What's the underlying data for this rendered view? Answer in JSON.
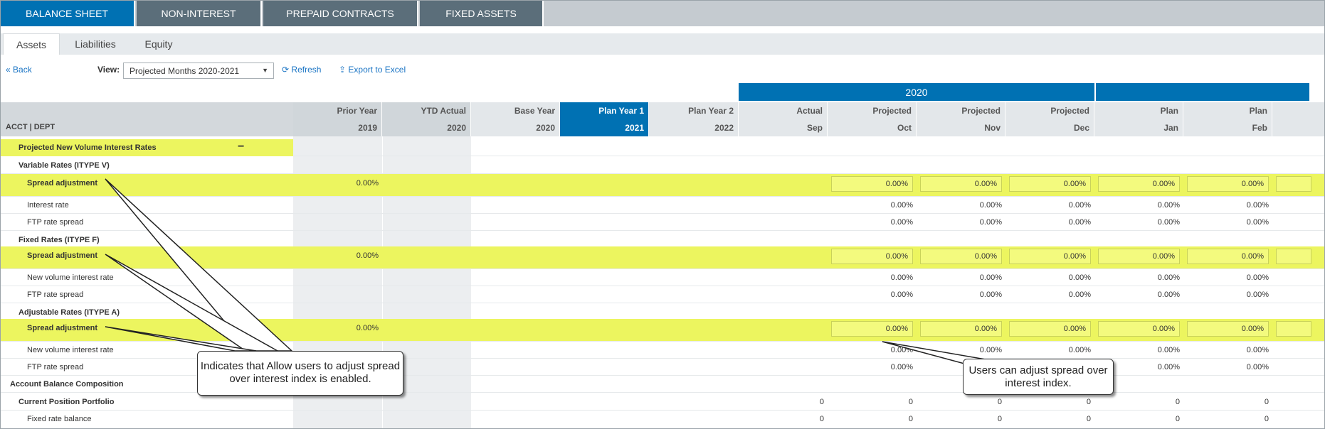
{
  "top_tabs": [
    {
      "label": "BALANCE SHEET",
      "active": true
    },
    {
      "label": "NON-INTEREST",
      "active": false
    },
    {
      "label": "PREPAID CONTRACTS",
      "active": false
    },
    {
      "label": "FIXED ASSETS",
      "active": false
    }
  ],
  "sub_tabs": [
    {
      "label": "Assets",
      "active": true
    },
    {
      "label": "Liabilities",
      "active": false
    },
    {
      "label": "Equity",
      "active": false
    }
  ],
  "toolbar": {
    "back_label": "Back",
    "view_label": "View:",
    "view_value": "Projected Months 2020-2021",
    "refresh_label": "Refresh",
    "export_label": "Export to Excel"
  },
  "year_band": "2020",
  "acct_header": "ACCT | DEPT",
  "columns": [
    {
      "l1": "Prior Year",
      "l2": "2019"
    },
    {
      "l1": "YTD Actual",
      "l2": "2020"
    },
    {
      "l1": "Base Year",
      "l2": "2020"
    },
    {
      "l1": "Plan Year 1",
      "l2": "2021"
    },
    {
      "l1": "Plan Year 2",
      "l2": "2022"
    },
    {
      "l1": "Actual",
      "l2": "Sep"
    },
    {
      "l1": "Projected",
      "l2": "Oct"
    },
    {
      "l1": "Projected",
      "l2": "Nov"
    },
    {
      "l1": "Projected",
      "l2": "Dec"
    },
    {
      "l1": "Plan",
      "l2": "Jan"
    },
    {
      "l1": "Plan",
      "l2": "Feb"
    }
  ],
  "rows": {
    "section_title": "Projected New Volume Interest Rates",
    "collapse_symbol": "−",
    "variable_title": "Variable Rates (ITYPE V)",
    "spread_label": "Spread adjustment",
    "prior_value": "0.00%",
    "interest_rate": "Interest rate",
    "ftp_rate_spread": "FTP rate spread",
    "fixed_title": "Fixed Rates (ITYPE F)",
    "new_volume_rate": "New volume interest rate",
    "adjustable_title": "Adjustable Rates (ITYPE A)",
    "account_balance": "Account Balance Composition",
    "current_position": "Current Position Portfolio",
    "fixed_rate_balance": "Fixed rate balance",
    "pct_value": "0.00%",
    "zero_value": "0"
  },
  "callouts": {
    "left": "Indicates that Allow users to adjust spread over interest index is enabled.",
    "right": "Users can adjust spread over interest index."
  },
  "colors": {
    "active_tab": "#0071b3",
    "inactive_tab": "#5b6e7a",
    "highlight_row": "#ecf55f",
    "link": "#1a74c4"
  }
}
